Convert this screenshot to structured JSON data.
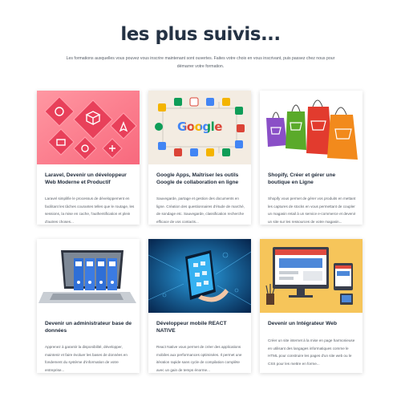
{
  "heading": "les plus suivis...",
  "intro": "Les formations auxquelles vous pouvez vous inscrire maintenant sont ouvertes. Faites votre choix en vous inscrivant, puis passez chez nous pour démarrer votre formation.",
  "courses": [
    {
      "title": "Laravel, Devenir un développeur Web Moderne et Productif",
      "description": "Laravel simplifie le processus de développement en facilitant les tâches courantes telles que le routage, les sessions, la mise en cache, l'authentification et plein d'autres choses..."
    },
    {
      "title": "Google Apps, Maîtriser les outils Google de collaboration en ligne",
      "description": "Sauvegarde, partage et gestion des documents en ligne. Création des questionnaires d'étude de marché, de sondage etc. Sauvegarde, classification recherche efficace de vos contacts...",
      "logo_text": "Google"
    },
    {
      "title": "Shopify, Créer et gérer une boutique en Ligne",
      "description": "Shopify vous permet de gérer vos produits en mettant les captures de stocks en vous permettant de coupler un magasin retail à un service e-commerce et devenir un site sur les ressources de votre magasin..."
    },
    {
      "title": "Devenir un administrateur base de données",
      "description": "Apprenez à garantir la disponibilité, développer, maintenir et faire évoluer les bases de données en fondement du système d'information de votre entreprise..."
    },
    {
      "title": "Développeur mobile REACT NATIVE",
      "description": "React Native vous permet de créer des applications mobiles aux performances optimisées. Il permet une itération rapide sans cycle de compilation complète avec un gain de temps énorme..."
    },
    {
      "title": "Devenir un Intégrateur Web",
      "description": "Créer un site internet à la mise en page harmonieuse en utilisant des langages informatiques comme le HTML pour construire les pages d'un site web ou le CSS pour les mettre en forme..."
    }
  ]
}
